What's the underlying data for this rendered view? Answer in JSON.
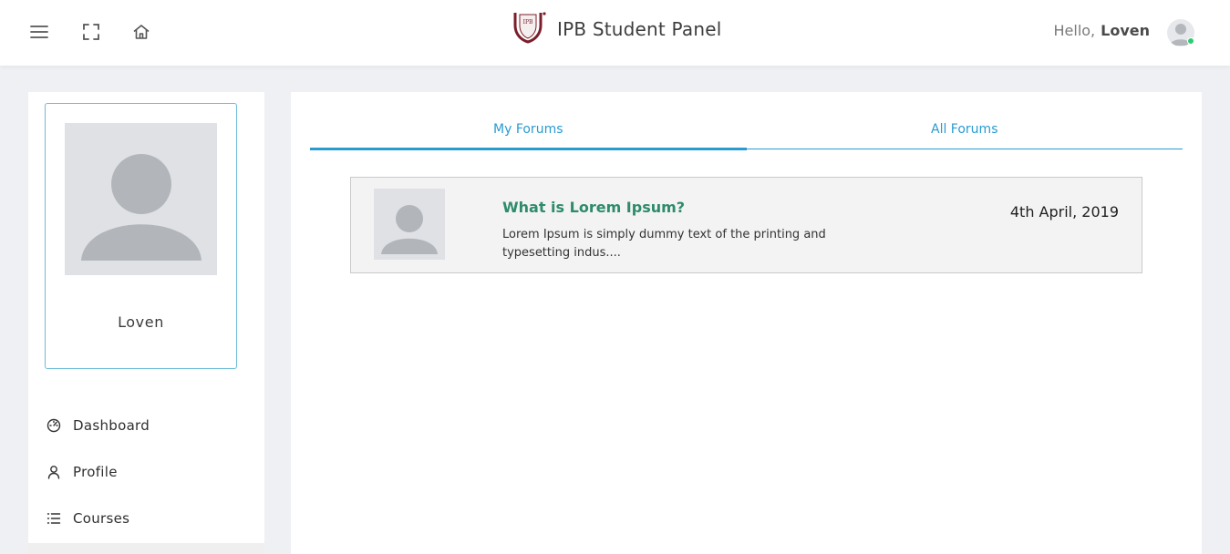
{
  "header": {
    "brand_logo_text": "IPB",
    "brand_title": "IPB Student Panel",
    "greeting": "Hello,",
    "user_name": "Loven",
    "icons": [
      "menu-icon",
      "fullscreen-icon",
      "home-icon"
    ]
  },
  "sidebar": {
    "profile_name": "Loven",
    "items": [
      {
        "label": "Dashboard",
        "icon": "dashboard-icon"
      },
      {
        "label": "Profile",
        "icon": "user-icon"
      },
      {
        "label": "Courses",
        "icon": "list-icon"
      }
    ]
  },
  "main": {
    "tabs": [
      {
        "label": "My Forums",
        "active": true
      },
      {
        "label": "All Forums",
        "active": false
      }
    ],
    "forums": [
      {
        "title": "What is Lorem Ipsum?",
        "excerpt": "Lorem Ipsum is simply dummy text of the printing and typesetting indus....",
        "date": "4th April, 2019"
      }
    ]
  },
  "colors": {
    "accent": "#2a9bd1",
    "forum_title": "#2e8b6b",
    "brand": "#7a1f2b",
    "online": "#2ecc71",
    "background": "#eef0f4"
  }
}
